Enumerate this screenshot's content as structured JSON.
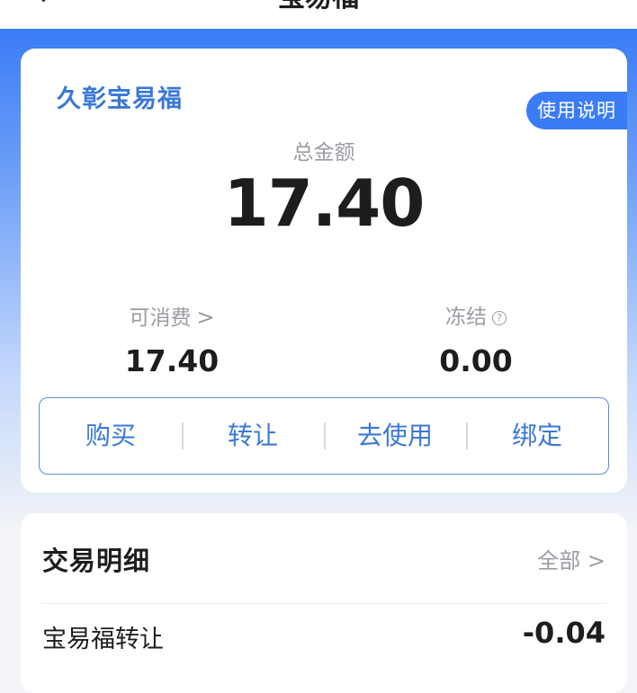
{
  "nav": {
    "title": "宝易福"
  },
  "account": {
    "name": "久彰宝易福",
    "guide_label": "使用说明",
    "total_label": "总金额",
    "total_value": "17.40",
    "spendable_label": "可消费",
    "spendable_value": "17.40",
    "frozen_label": "冻结",
    "frozen_value": "0.00"
  },
  "actions": [
    {
      "label": "购买"
    },
    {
      "label": "转让"
    },
    {
      "label": "去使用"
    },
    {
      "label": "绑定"
    }
  ],
  "transactions": {
    "title": "交易明细",
    "all_label": "全部 >",
    "rows": [
      {
        "label": "宝易福转让",
        "amount": "-0.04"
      }
    ]
  },
  "colors": {
    "accent": "#3b7cf6",
    "accent_text": "#3a78d8",
    "muted_text": "#9a9ca3"
  },
  "icons": {
    "back": "chevron-left-icon",
    "spendable_arrow": "chevron-right-icon",
    "frozen_help": "question-circle-icon"
  }
}
